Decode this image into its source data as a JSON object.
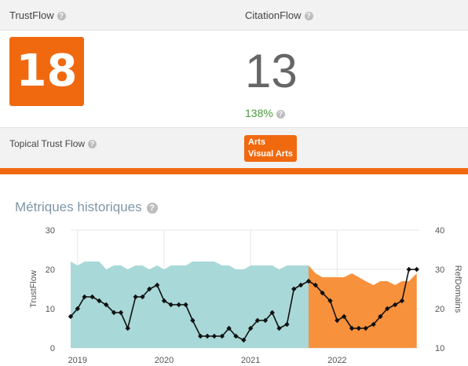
{
  "header": {
    "trustflow_label": "TrustFlow",
    "citationflow_label": "CitationFlow"
  },
  "trustflow_value": "18",
  "citationflow_value": "13",
  "ratio": "138%",
  "topical": {
    "label": "Topical Trust Flow",
    "tags": [
      "Arts",
      "Visual Arts"
    ]
  },
  "history": {
    "title": "Métriques historiques",
    "help_icon": "?"
  },
  "colors": {
    "accent": "#f0690f",
    "teal": "#a8d8d8",
    "orange_area": "#f7913c",
    "ratio_green": "#4a9a3a"
  },
  "chart_data": {
    "type": "line",
    "ylabel_left": "TrustFlow",
    "ylabel_right": "RefDomains",
    "ylim_left": [
      0,
      30
    ],
    "ylim_right": [
      10,
      40
    ],
    "yticks_left": [
      "0",
      "10",
      "20",
      "30"
    ],
    "yticks_right": [
      "10",
      "20",
      "30",
      "40"
    ],
    "x_ticks": [
      "2019",
      "2020",
      "2021",
      "2022"
    ],
    "x_tick_dates": [
      2019.0,
      2020.0,
      2021.0,
      2022.0
    ],
    "x_range": [
      2018.92,
      2022.95
    ],
    "grid": true,
    "series": [
      {
        "name": "TrustFlow",
        "kind": "line-markers",
        "x": [
          2018.92,
          2019.0,
          2019.08,
          2019.17,
          2019.25,
          2019.33,
          2019.42,
          2019.5,
          2019.58,
          2019.67,
          2019.75,
          2019.83,
          2019.92,
          2020.0,
          2020.08,
          2020.17,
          2020.25,
          2020.33,
          2020.42,
          2020.5,
          2020.58,
          2020.67,
          2020.75,
          2020.83,
          2020.92,
          2021.0,
          2021.08,
          2021.17,
          2021.25,
          2021.33,
          2021.42,
          2021.5,
          2021.58,
          2021.67,
          2021.75,
          2021.83,
          2021.92,
          2022.0,
          2022.08,
          2022.17,
          2022.25,
          2022.33,
          2022.42,
          2022.5,
          2022.58,
          2022.67,
          2022.75,
          2022.83,
          2022.92
        ],
        "y": [
          8,
          10,
          13,
          13,
          12,
          11,
          9,
          9,
          5,
          13,
          13,
          15,
          16,
          12,
          11,
          11,
          11,
          7,
          3,
          3,
          3,
          3,
          5,
          3,
          2,
          5,
          7,
          7,
          9,
          5,
          6,
          15,
          16,
          17,
          16,
          14,
          12,
          7,
          8,
          5,
          5,
          5,
          6,
          8,
          10,
          11,
          12,
          20,
          20
        ]
      },
      {
        "name": "RefDomains",
        "kind": "area",
        "x": [
          2018.92,
          2019.0,
          2019.08,
          2019.17,
          2019.25,
          2019.33,
          2019.42,
          2019.5,
          2019.58,
          2019.67,
          2019.75,
          2019.83,
          2019.92,
          2020.0,
          2020.08,
          2020.17,
          2020.25,
          2020.33,
          2020.42,
          2020.5,
          2020.58,
          2020.67,
          2020.75,
          2020.83,
          2020.92,
          2021.0,
          2021.08,
          2021.17,
          2021.25,
          2021.33,
          2021.42,
          2021.5,
          2021.58,
          2021.67,
          2021.75,
          2021.83,
          2021.92,
          2022.0,
          2022.08,
          2022.17,
          2022.25,
          2022.33,
          2022.42,
          2022.5,
          2022.58,
          2022.67,
          2022.75,
          2022.83,
          2022.92
        ],
        "y": [
          32,
          31,
          32,
          32,
          32,
          30,
          31,
          31,
          30,
          31,
          31,
          30,
          31,
          30,
          31,
          31,
          31,
          32,
          32,
          32,
          32,
          31,
          31,
          30,
          30,
          31,
          31,
          31,
          31,
          30,
          31,
          31,
          31,
          31,
          29,
          28,
          28,
          28,
          28,
          29,
          28,
          27,
          26,
          27,
          27,
          26,
          27,
          27,
          29
        ],
        "split_at": 2021.67,
        "colors_before_after": [
          "#a8d8d8",
          "#f7913c"
        ]
      }
    ]
  }
}
